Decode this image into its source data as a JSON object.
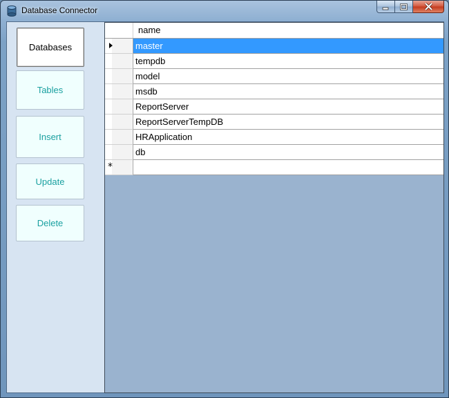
{
  "window": {
    "title": "Database Connector",
    "caption_buttons": {
      "minimize": "minimize-icon",
      "maximize": "maximize-icon",
      "close": "close-icon"
    }
  },
  "nav": {
    "databases": "Databases",
    "tables": "Tables",
    "insert": "Insert",
    "update": "Update",
    "delete": "Delete"
  },
  "grid": {
    "column": "name",
    "rows": [
      "master",
      "tempdb",
      "model",
      "msdb",
      "ReportServer",
      "ReportServerTempDB",
      "HRApplication",
      "db"
    ],
    "selected_index": 0,
    "new_row_marker": "*"
  },
  "colors": {
    "selection": "#3399ff",
    "nav_text": "#1aa0a0",
    "grid_background": "#9ab3cf"
  }
}
